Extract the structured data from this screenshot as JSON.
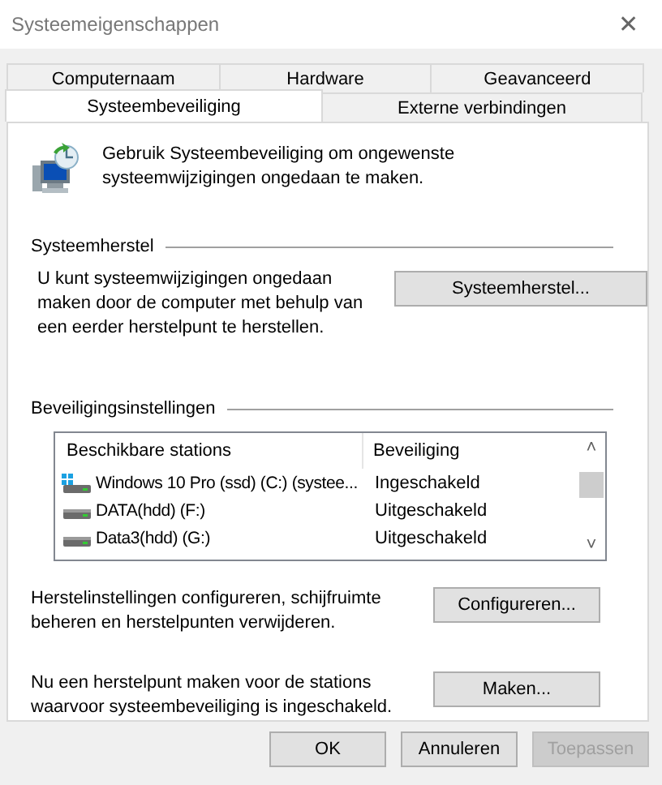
{
  "window": {
    "title": "Systeemeigenschappen",
    "close": "✕"
  },
  "tabs": [
    [
      {
        "label": "Computernaam",
        "selected": false
      },
      {
        "label": "Hardware",
        "selected": false
      },
      {
        "label": "Geavanceerd",
        "selected": false
      }
    ],
    [
      {
        "label": "Systeembeveiliging",
        "selected": true
      },
      {
        "label": "Externe verbindingen",
        "selected": false
      }
    ]
  ],
  "intro": "Gebruik Systeembeveiliging om ongewenste systeemwijzigingen ongedaan te maken.",
  "restore": {
    "heading": "Systeemherstel",
    "text": "U kunt systeemwijzigingen ongedaan maken door de computer met behulp van een eerder herstelpunt te herstellen.",
    "button": "Systeemherstel..."
  },
  "protection": {
    "heading": "Beveiligingsinstellingen",
    "columns": [
      "Beschikbare stations",
      "Beveiliging"
    ],
    "rows": [
      {
        "kind": "system",
        "name": "Windows 10 Pro (ssd) (C:) (systee...",
        "status": "Ingeschakeld"
      },
      {
        "kind": "disk",
        "name": "DATA(hdd) (F:)",
        "status": "Uitgeschakeld"
      },
      {
        "kind": "disk",
        "name": "Data3(hdd) (G:)",
        "status": "Uitgeschakeld"
      }
    ],
    "scroll_up": "˄",
    "scroll_down": "˅"
  },
  "configure": {
    "text": "Herstelinstellingen configureren, schijfruimte beheren en herstelpunten verwijderen.",
    "button": "Configureren..."
  },
  "create": {
    "text": "Nu een herstelpunt maken voor de stations waarvoor systeembeveiliging is ingeschakeld.",
    "button": "Maken..."
  },
  "buttons": [
    {
      "label": "OK",
      "disabled": false
    },
    {
      "label": "Annuleren",
      "disabled": false
    },
    {
      "label": "Toepassen",
      "disabled": true
    }
  ]
}
